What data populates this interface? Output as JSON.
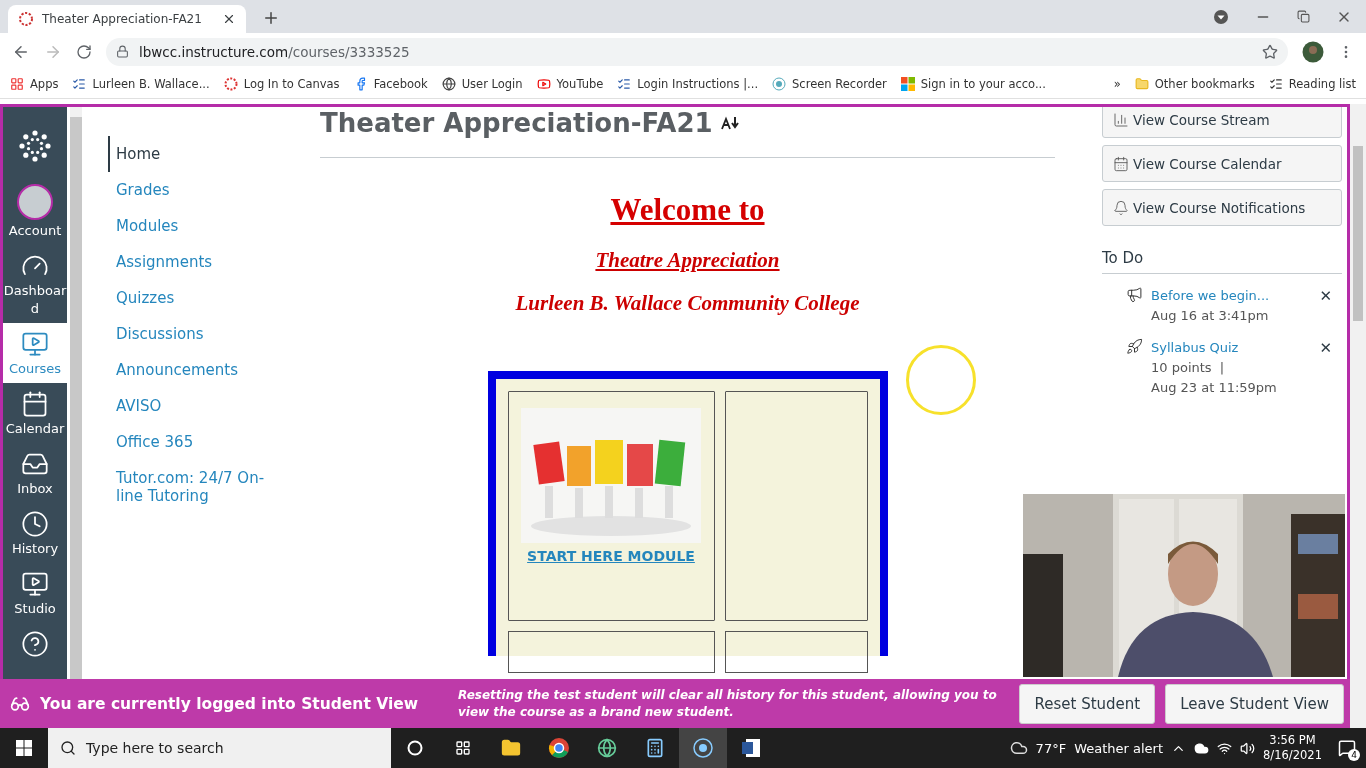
{
  "browser": {
    "tab_title": "Theater Appreciation-FA21",
    "url_host": "lbwcc.instructure.com",
    "url_path": "/courses/3333525",
    "bookmarks": [
      {
        "kind": "apps",
        "label": "Apps"
      },
      {
        "kind": "college",
        "label": "Lurleen B. Wallace..."
      },
      {
        "kind": "canvas",
        "label": "Log In to Canvas"
      },
      {
        "kind": "facebook",
        "label": "Facebook"
      },
      {
        "kind": "globe",
        "label": "User Login"
      },
      {
        "kind": "youtube",
        "label": "YouTube"
      },
      {
        "kind": "college",
        "label": "Login Instructions |..."
      },
      {
        "kind": "recorder",
        "label": "Screen Recorder"
      },
      {
        "kind": "microsoft",
        "label": "Sign in to your acco..."
      }
    ],
    "more": "»",
    "other_bookmarks": "Other bookmarks",
    "reading_list": "Reading list"
  },
  "global_nav": [
    {
      "kind": "account",
      "label": "Account",
      "selected": false
    },
    {
      "kind": "dashboard",
      "label": "Dashboard",
      "selected": false
    },
    {
      "kind": "courses",
      "label": "Courses",
      "selected": true
    },
    {
      "kind": "calendar",
      "label": "Calendar",
      "selected": false
    },
    {
      "kind": "inbox",
      "label": "Inbox",
      "selected": false
    },
    {
      "kind": "history",
      "label": "History",
      "selected": false
    },
    {
      "kind": "studio",
      "label": "Studio",
      "selected": false
    },
    {
      "kind": "help",
      "selected": false
    }
  ],
  "course_nav": [
    {
      "label": "Home",
      "selected": true
    },
    {
      "label": "Grades",
      "selected": false
    },
    {
      "label": "Modules",
      "selected": false
    },
    {
      "label": "Assignments",
      "selected": false
    },
    {
      "label": "Quizzes",
      "selected": false
    },
    {
      "label": "Discussions",
      "selected": false
    },
    {
      "label": "Announcements",
      "selected": false
    },
    {
      "label": "AVISO",
      "selected": false
    },
    {
      "label": "Office 365",
      "selected": false
    },
    {
      "label": "Tutor.com: 24/7 On-line Tutoring",
      "selected": false
    }
  ],
  "course_title": "Theater Appreciation-FA21",
  "welcome": {
    "heading": "Welcome to",
    "course": "Theatre Appreciation",
    "college": "Lurleen B. Wallace Community College"
  },
  "module_link": "START HERE MODULE",
  "sidebar_buttons": [
    {
      "kind": "stream",
      "label": "View Course Stream"
    },
    {
      "kind": "calendar",
      "label": "View Course Calendar"
    },
    {
      "kind": "bell",
      "label": "View Course Notifications"
    }
  ],
  "todo": {
    "heading": "To Do",
    "items": [
      {
        "kind": "announcement",
        "title": "Before we begin...",
        "lines": [
          "Aug 16 at 3:41pm"
        ]
      },
      {
        "kind": "quiz",
        "title": "Syllabus Quiz",
        "lines": [
          "10 points  |",
          "Aug 23 at 11:59pm"
        ]
      }
    ],
    "dismiss": "✕"
  },
  "student_view": {
    "message": "You are currently logged into Student View",
    "note": "Resetting the test student will clear all history for this student, allowing you to view the course as a brand new student.",
    "buttons": [
      "Reset Student",
      "Leave Student View"
    ]
  },
  "taskbar": {
    "search_placeholder": "Type here to search",
    "temperature": "77°F",
    "weather": "Weather alert",
    "time": "3:56 PM",
    "date": "8/16/2021",
    "notifications": "4"
  }
}
